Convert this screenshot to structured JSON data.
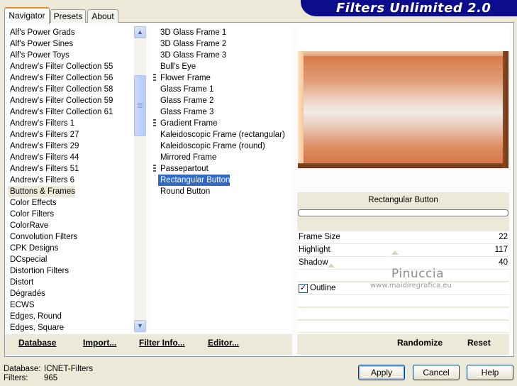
{
  "tabs": [
    "Navigator",
    "Presets",
    "About"
  ],
  "banner": "Filters Unlimited 2.0",
  "categories": [
    "Alf's Power Grads",
    "Alf's Power Sines",
    "Alf's Power Toys",
    "Andrew's Filter Collection 55",
    "Andrew's Filter Collection 56",
    "Andrew's Filter Collection 58",
    "Andrew's Filter Collection 59",
    "Andrew's Filter Collection 61",
    "Andrew's Filters 1",
    "Andrew's Filters 27",
    "Andrew's Filters 29",
    "Andrew's Filters 44",
    "Andrew's Filters 51",
    "Andrew's Filters 6",
    "Buttons & Frames",
    "Color Effects",
    "Color Filters",
    "ColorRave",
    "Convolution Filters",
    "CPK Designs",
    "DCspecial",
    "Distortion Filters",
    "Distort",
    "Dégradés",
    "ECWS",
    "Edges, Round",
    "Edges, Square"
  ],
  "selected_category": "Buttons & Frames",
  "filters": [
    {
      "name": "3D Glass Frame 1",
      "marked": false
    },
    {
      "name": "3D Glass Frame 2",
      "marked": false
    },
    {
      "name": "3D Glass Frame 3",
      "marked": false
    },
    {
      "name": "Bull's Eye",
      "marked": false
    },
    {
      "name": "Flower Frame",
      "marked": true
    },
    {
      "name": "Glass Frame 1",
      "marked": false
    },
    {
      "name": "Glass Frame 2",
      "marked": false
    },
    {
      "name": "Glass Frame 3",
      "marked": false
    },
    {
      "name": "Gradient Frame",
      "marked": true
    },
    {
      "name": "Kaleidoscopic Frame (rectangular)",
      "marked": false
    },
    {
      "name": "Kaleidoscopic Frame (round)",
      "marked": false
    },
    {
      "name": "Mirrored Frame",
      "marked": false
    },
    {
      "name": "Passepartout",
      "marked": true
    },
    {
      "name": "Rectangular Button",
      "marked": false
    },
    {
      "name": "Round Button",
      "marked": false
    }
  ],
  "selected_filter": "Rectangular Button",
  "filter_title": "Rectangular Button",
  "params": {
    "frame_size_label": "Frame Size",
    "frame_size": "22",
    "highlight_label": "Highlight",
    "highlight": "117",
    "shadow_label": "Shadow",
    "shadow": "40",
    "outline_label": "Outline",
    "outline_checked": true
  },
  "watermark": {
    "name": "Pinuccia",
    "url": "www.maidiregrafica.eu"
  },
  "toolbar": {
    "database": "Database",
    "import": "Import...",
    "filter_info": "Filter Info...",
    "editor": "Editor...",
    "randomize": "Randomize",
    "reset": "Reset"
  },
  "status": {
    "database_label": "Database:",
    "database_value": "ICNET-Filters",
    "filters_label": "Filters:",
    "filters_value": "965"
  },
  "buttons": {
    "apply": "Apply",
    "cancel": "Cancel",
    "help": "Help"
  },
  "colors": {
    "banner": "#0c0d8c",
    "selection": "#316ac5",
    "frame_base": "#d87a4b"
  }
}
